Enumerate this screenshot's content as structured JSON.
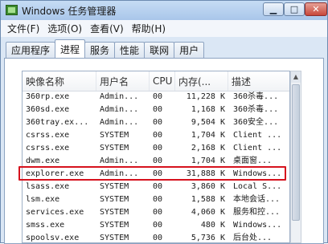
{
  "window": {
    "title": "Windows 任务管理器",
    "min_symbol": "▁",
    "max_symbol": "□",
    "close_symbol": "✕"
  },
  "menu": [
    "文件(F)",
    "选项(O)",
    "查看(V)",
    "帮助(H)"
  ],
  "tabs": [
    "应用程序",
    "进程",
    "服务",
    "性能",
    "联网",
    "用户"
  ],
  "active_tab": "进程",
  "columns": [
    "映像名称",
    "用户名",
    "CPU",
    "内存(...",
    "描述"
  ],
  "processes": [
    {
      "name": "360rp.exe",
      "user": "Admin...",
      "cpu": "00",
      "mem": "11,228 K",
      "desc": "360杀毒..."
    },
    {
      "name": "360sd.exe",
      "user": "Admin...",
      "cpu": "00",
      "mem": "1,168 K",
      "desc": "360杀毒..."
    },
    {
      "name": "360tray.ex...",
      "user": "Admin...",
      "cpu": "00",
      "mem": "9,504 K",
      "desc": "360安全..."
    },
    {
      "name": "csrss.exe",
      "user": "SYSTEM",
      "cpu": "00",
      "mem": "1,704 K",
      "desc": "Client ..."
    },
    {
      "name": "csrss.exe",
      "user": "SYSTEM",
      "cpu": "00",
      "mem": "2,168 K",
      "desc": "Client ..."
    },
    {
      "name": "dwm.exe",
      "user": "Admin...",
      "cpu": "00",
      "mem": "1,704 K",
      "desc": "桌面窗..."
    },
    {
      "name": "explorer.exe",
      "user": "Admin...",
      "cpu": "00",
      "mem": "31,888 K",
      "desc": "Windows..."
    },
    {
      "name": "lsass.exe",
      "user": "SYSTEM",
      "cpu": "00",
      "mem": "3,860 K",
      "desc": "Local S..."
    },
    {
      "name": "lsm.exe",
      "user": "SYSTEM",
      "cpu": "00",
      "mem": "1,588 K",
      "desc": "本地会话..."
    },
    {
      "name": "services.exe",
      "user": "SYSTEM",
      "cpu": "00",
      "mem": "4,060 K",
      "desc": "服务和控..."
    },
    {
      "name": "smss.exe",
      "user": "SYSTEM",
      "cpu": "00",
      "mem": "480 K",
      "desc": "Windows..."
    },
    {
      "name": "spoolsv.exe",
      "user": "SYSTEM",
      "cpu": "00",
      "mem": "5,736 K",
      "desc": "后台处..."
    }
  ],
  "selected_process": "explorer.exe",
  "colors": {
    "highlight": "#d6121d"
  }
}
